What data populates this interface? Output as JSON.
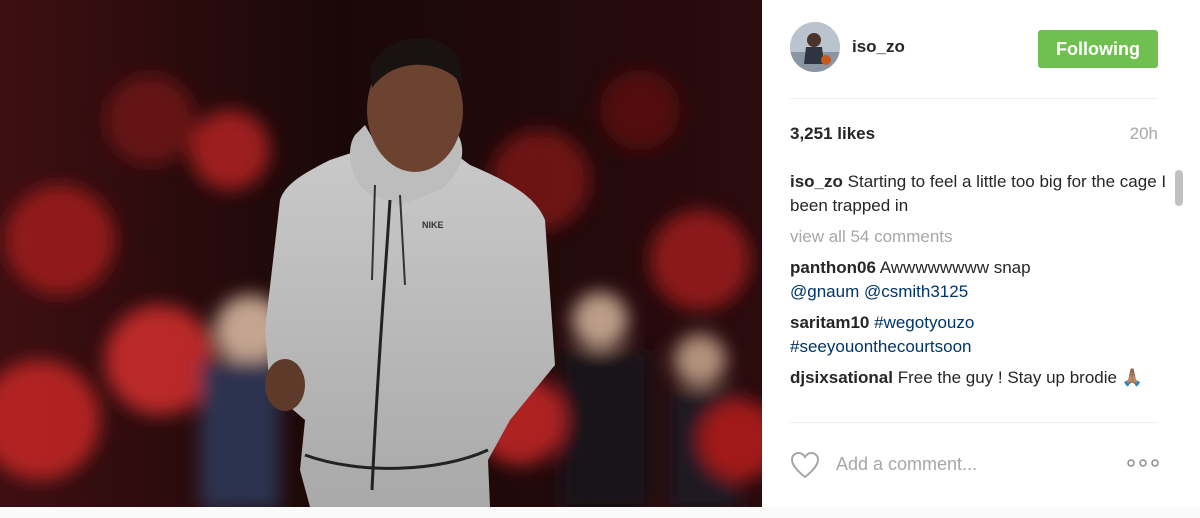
{
  "post": {
    "username": "iso_zo",
    "follow_label": "Following",
    "likes": "3,251 likes",
    "time": "20h"
  },
  "caption": {
    "user": "iso_zo",
    "text": "Starting to feel a little too big for the cage I been trapped in"
  },
  "view_all": "view all 54 comments",
  "comments": [
    {
      "user": "panthon06",
      "text": "Awwwwwwww snap",
      "mentions": "@gnaum @csmith3125"
    },
    {
      "user": "saritam10",
      "tag1": "#wegotyouzo",
      "tag2": "#seeyouonthecourtsoon"
    },
    {
      "user": "djsixsational",
      "text": "Free the guy ! Stay up brodie 🙏🏽"
    }
  ],
  "compose": {
    "placeholder": "Add a comment..."
  },
  "photo": {
    "logo_text": "NIKE"
  },
  "icons": {
    "like": "heart-icon",
    "options": "more-options-icon"
  },
  "colors": {
    "follow": "#70c050",
    "link": "#003569",
    "muted": "#a5a7aa"
  }
}
